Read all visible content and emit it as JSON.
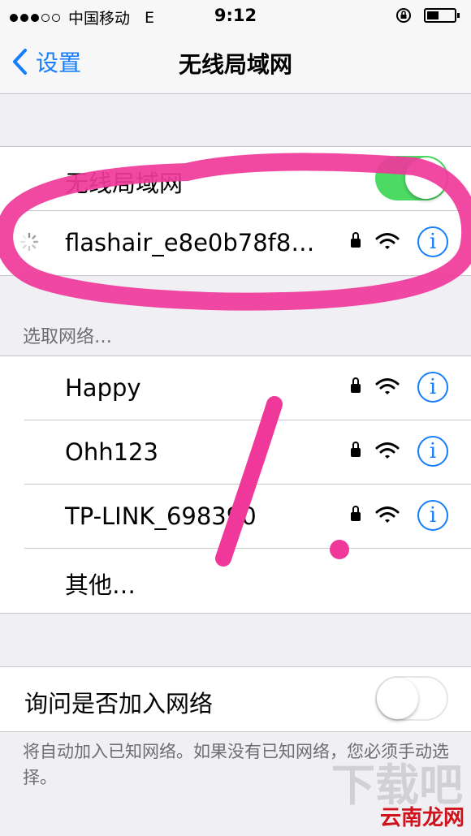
{
  "status_bar": {
    "carrier": "中国移动",
    "network": "E",
    "time": "9:12",
    "signal_bars_filled": 3,
    "signal_bars_total": 5,
    "battery_level": 0.45
  },
  "nav": {
    "back_label": "设置",
    "title": "无线局域网"
  },
  "wifi_toggle": {
    "label": "无线局域网",
    "on": true
  },
  "current_network": {
    "name": "flashair_e8e0b78f8…",
    "secured": true
  },
  "choose_network_header": "选取网络…",
  "networks": [
    {
      "name": "Happy",
      "secured": true
    },
    {
      "name": "Ohh123",
      "secured": true
    },
    {
      "name": "TP-LINK_698390",
      "secured": true
    }
  ],
  "other_label": "其他…",
  "ask_to_join": {
    "label": "询问是否加入网络",
    "on": false
  },
  "footer_note": "将自动加入已知网络。如果没有已知网络，您必须手动选择。",
  "watermark": {
    "text": "云南龙网",
    "bg_text": "下载吧"
  },
  "colors": {
    "accent": "#157efb",
    "toggle_on": "#4cd964",
    "annotation": "#f0389a"
  },
  "icons": {
    "back": "chevron-left-icon",
    "lock": "lock-icon",
    "wifi": "wifi-icon",
    "info": "info-icon",
    "spinner": "spinner-icon"
  },
  "info_glyph": "i"
}
